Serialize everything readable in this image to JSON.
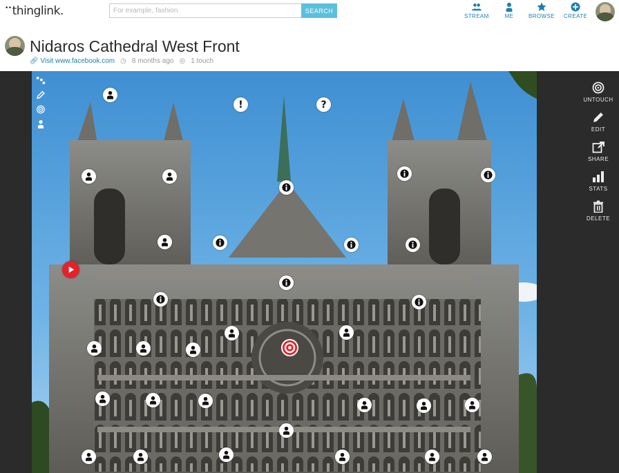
{
  "header": {
    "logo": "thinglink.",
    "search": {
      "placeholder": "For example, fashion",
      "button": "SEARCH"
    },
    "nav": [
      {
        "label": "STREAM",
        "icon": "stream-icon"
      },
      {
        "label": "ME",
        "icon": "user-icon"
      },
      {
        "label": "BROWSE",
        "icon": "star-icon"
      },
      {
        "label": "CREATE",
        "icon": "plus-circle-icon"
      }
    ]
  },
  "page": {
    "title": "Nidaros Cathedral West Front",
    "link": "Visit www.facebook.com",
    "age": "8 months ago",
    "touches": "1 touch"
  },
  "tools": [
    {
      "label": "UNTOUCH",
      "icon": "target-icon"
    },
    {
      "label": "EDIT",
      "icon": "pencil-icon"
    },
    {
      "label": "SHARE",
      "icon": "share-icon"
    },
    {
      "label": "STATS",
      "icon": "bar-chart-icon"
    },
    {
      "label": "DELETE",
      "icon": "trash-icon"
    }
  ],
  "tags": {
    "exclamation": "!",
    "question": "?"
  }
}
